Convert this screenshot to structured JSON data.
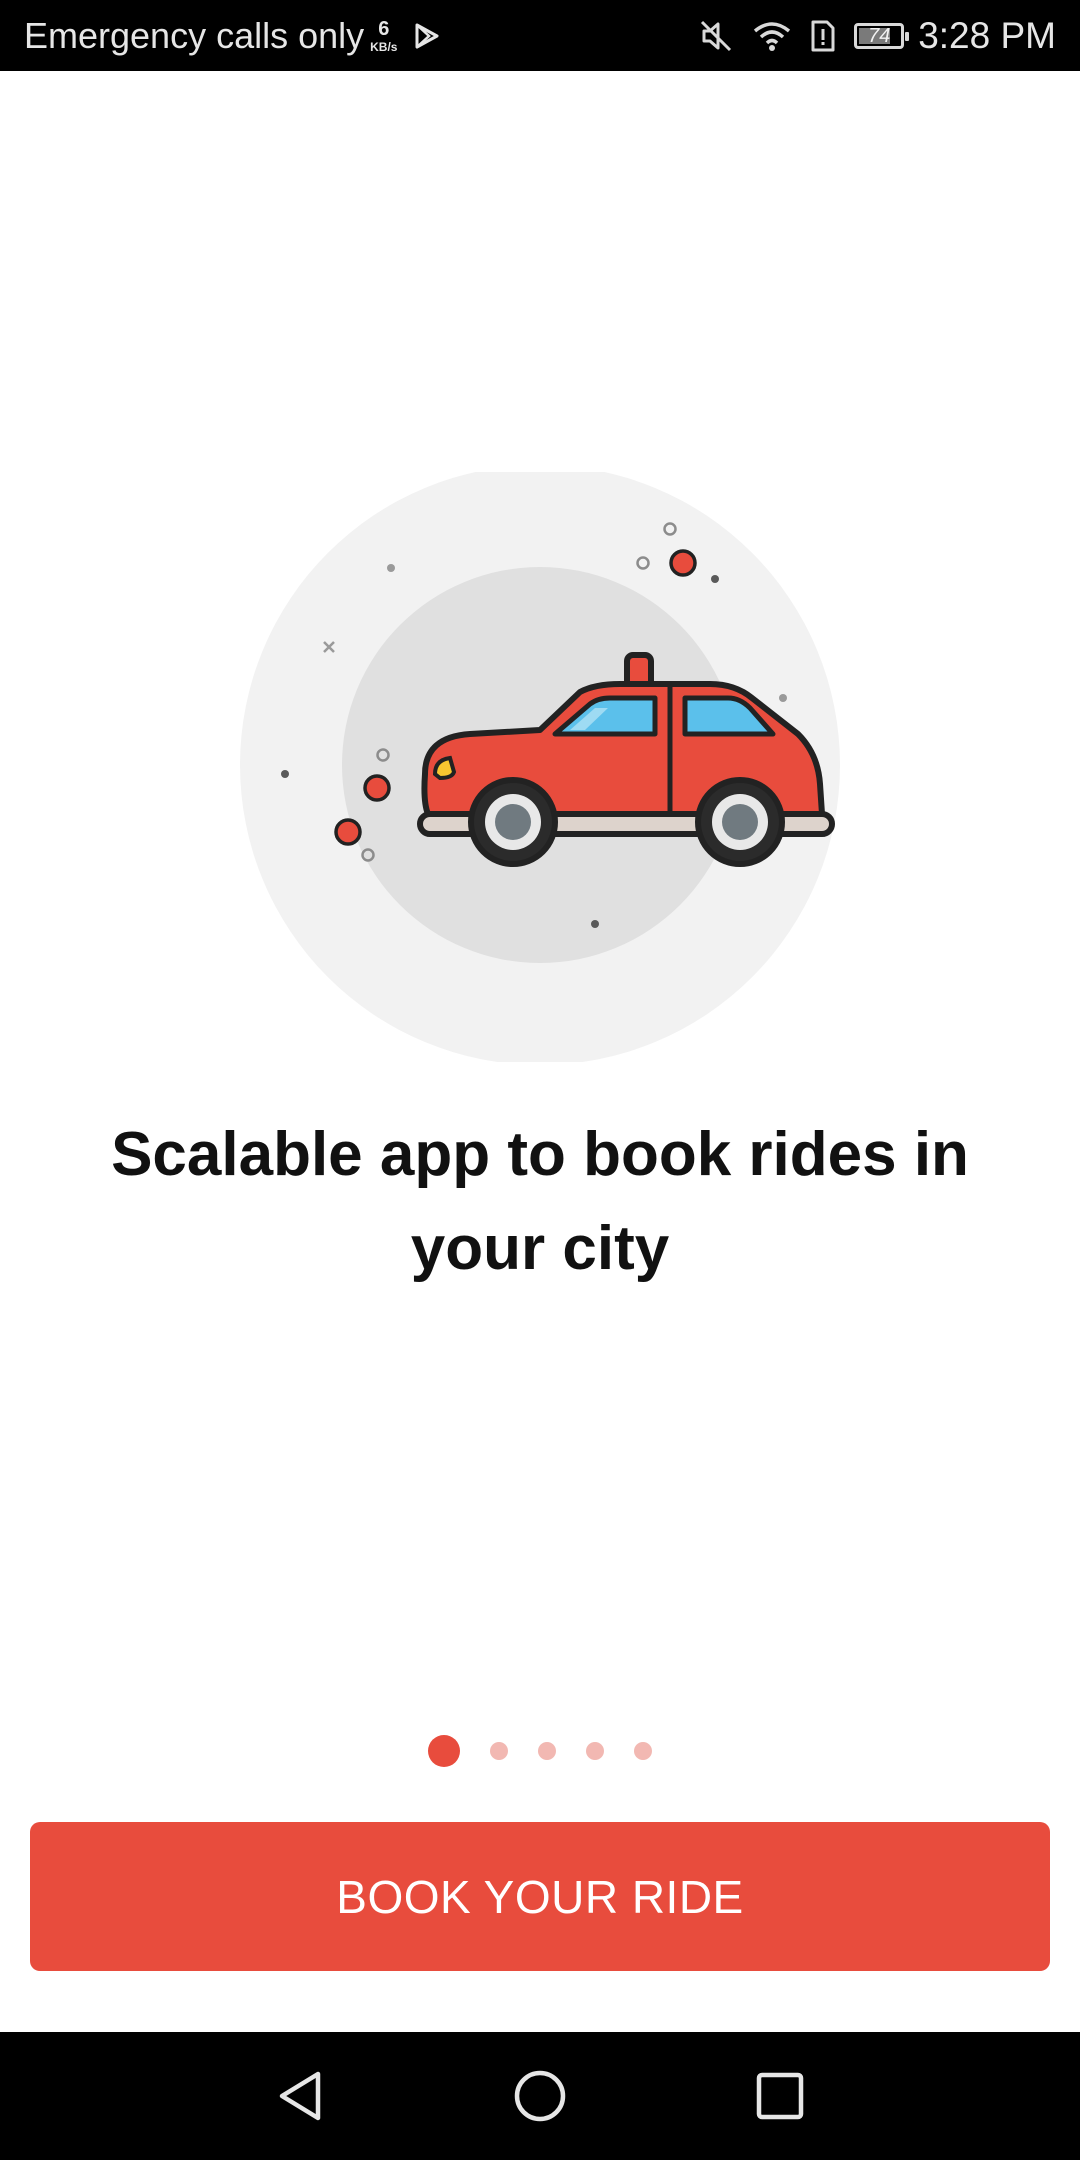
{
  "status_bar": {
    "carrier_text": "Emergency calls only",
    "net_speed_value": "6",
    "net_speed_unit": "KB/s",
    "battery_level": "74",
    "time": "3:28 PM",
    "icons": [
      "play-store-icon",
      "mute-icon",
      "wifi-icon",
      "sim-alert-icon",
      "battery-icon"
    ]
  },
  "onboarding": {
    "headline": "Scalable app to book rides in your city",
    "illustration": "car-icon",
    "pages_total": 5,
    "active_page": 1
  },
  "cta": {
    "label": "BOOK YOUR RIDE"
  },
  "nav_bar": {
    "buttons": [
      "back-icon",
      "home-icon",
      "recents-icon"
    ]
  },
  "colors": {
    "accent": "#e84c3d",
    "dot_inactive": "#f2b8b2",
    "car_body": "#e84c3d",
    "car_window": "#5bc0eb",
    "bg_outer_circle": "#f2f2f2",
    "bg_inner_circle": "#e0e0e0"
  }
}
